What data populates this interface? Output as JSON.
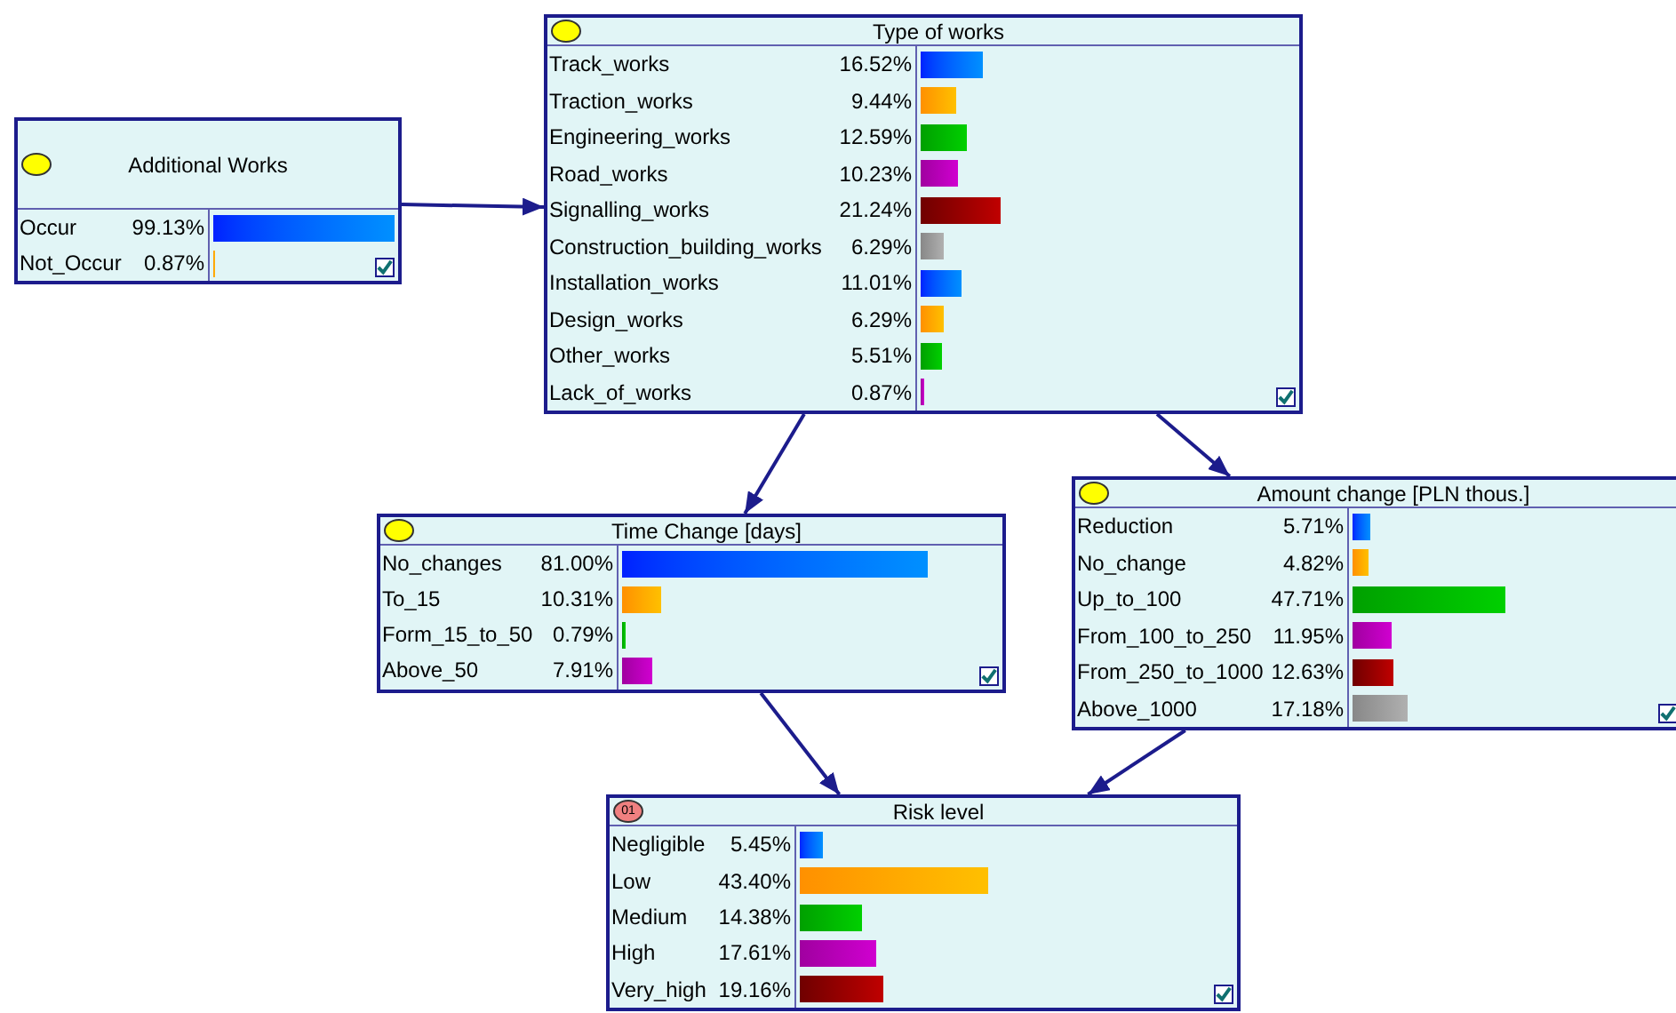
{
  "nodes": [
    {
      "title": "Additional Works",
      "kind": "chance",
      "checked": true,
      "states": [
        {
          "label": "Occur",
          "value": "99.13%",
          "level": 0.9913
        },
        {
          "label": "Not_Occur",
          "value": "0.87%",
          "level": 0.0087
        }
      ]
    },
    {
      "title": "Type of works",
      "kind": "chance",
      "checked": true,
      "states": [
        {
          "label": "Track_works",
          "value": "16.52%",
          "level": 0.1652
        },
        {
          "label": "Traction_works",
          "value": "9.44%",
          "level": 0.0944
        },
        {
          "label": "Engineering_works",
          "value": "12.59%",
          "level": 0.1259
        },
        {
          "label": "Road_works",
          "value": "10.23%",
          "level": 0.1023
        },
        {
          "label": "Signalling_works",
          "value": "21.24%",
          "level": 0.2124
        },
        {
          "label": "Construction_building_works",
          "value": "6.29%",
          "level": 0.0629
        },
        {
          "label": "Installation_works",
          "value": "11.01%",
          "level": 0.1101
        },
        {
          "label": "Design_works",
          "value": "6.29%",
          "level": 0.0629
        },
        {
          "label": "Other_works",
          "value": "5.51%",
          "level": 0.0551
        },
        {
          "label": "Lack_of_works",
          "value": "0.87%",
          "level": 0.0087
        }
      ]
    },
    {
      "title": "Time Change [days]",
      "kind": "chance",
      "checked": true,
      "states": [
        {
          "label": "No_changes",
          "value": "81.00%",
          "level": 0.81
        },
        {
          "label": "To_15",
          "value": "10.31%",
          "level": 0.1031
        },
        {
          "label": "Form_15_to_50",
          "value": "0.79%",
          "level": 0.0079
        },
        {
          "label": "Above_50",
          "value": "7.91%",
          "level": 0.0791
        }
      ]
    },
    {
      "title": "Amount change [PLN thous.]",
      "kind": "chance",
      "checked": true,
      "states": [
        {
          "label": "Reduction",
          "value": "5.71%",
          "level": 0.0571
        },
        {
          "label": "No_change",
          "value": "4.82%",
          "level": 0.0482
        },
        {
          "label": "Up_to_100",
          "value": "47.71%",
          "level": 0.4771
        },
        {
          "label": "From_100_to_250",
          "value": "11.95%",
          "level": 0.1195
        },
        {
          "label": "From_250_to_1000",
          "value": "12.63%",
          "level": 0.1263
        },
        {
          "label": "Above_1000",
          "value": "17.18%",
          "level": 0.1718
        }
      ]
    },
    {
      "title": "Risk level",
      "kind": "equation",
      "icon_text": "01",
      "checked": true,
      "states": [
        {
          "label": "Negligible",
          "value": "5.45%",
          "level": 0.0545
        },
        {
          "label": "Low",
          "value": "43.40%",
          "level": 0.434
        },
        {
          "label": "Medium",
          "value": "14.38%",
          "level": 0.1438
        },
        {
          "label": "High",
          "value": "17.61%",
          "level": 0.1761
        },
        {
          "label": "Very_high",
          "value": "19.16%",
          "level": 0.1916
        }
      ]
    }
  ]
}
